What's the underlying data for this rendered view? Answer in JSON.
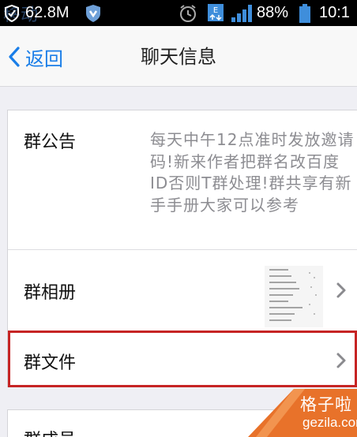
{
  "status_bar": {
    "ghost_text": "移动",
    "data_usage": "62.8M",
    "battery_percent": "88%",
    "time": "10:1",
    "icons": [
      "shield-icon",
      "vpn-shield-icon",
      "alarm-icon",
      "data-transfer-icon",
      "signal-icon",
      "battery-icon"
    ]
  },
  "nav": {
    "back_label": "返回",
    "title": "聊天信息"
  },
  "rows": {
    "notice_label": "群公告",
    "notice_text": "每天中午12点准时发放邀请码!新来作者把群名改百度ID否则T群处理!群共享有新手手册大家可以参考",
    "album_label": "群相册",
    "files_label": "群文件",
    "members_label": "群成员"
  },
  "watermark": {
    "top": "格子啦",
    "bottom": "gezila.com"
  },
  "colors": {
    "accent": "#1a7ee8",
    "highlight": "#c62424",
    "watermark": "#e8722a"
  }
}
